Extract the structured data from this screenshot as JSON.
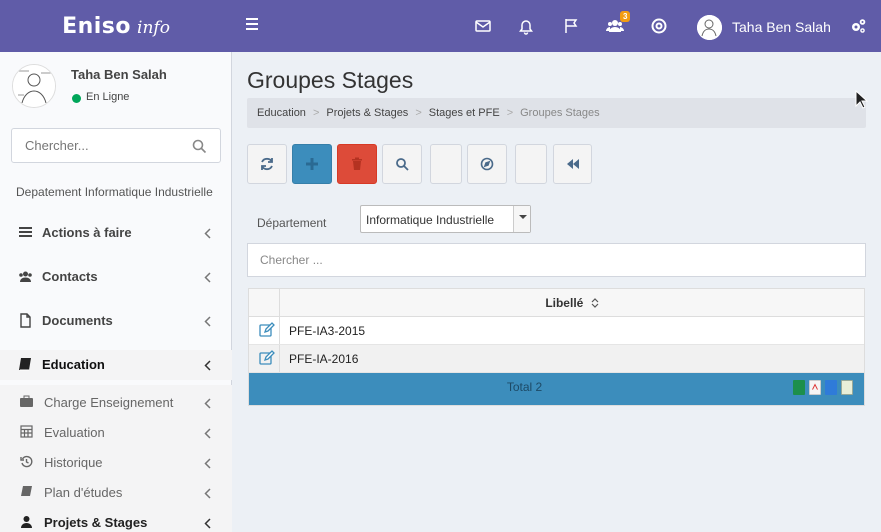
{
  "brand": {
    "name": "Eniso",
    "suffix": "info"
  },
  "topbar": {
    "badge_count": "3",
    "user_name": "Taha Ben Salah"
  },
  "sidebar": {
    "user_name": "Taha Ben Salah",
    "status": "En Ligne",
    "search_placeholder": "Chercher...",
    "header": "Depatement Informatique Industrielle",
    "items": [
      {
        "label": "Actions à faire",
        "icon": "list-icon"
      },
      {
        "label": "Contacts",
        "icon": "users-icon"
      },
      {
        "label": "Documents",
        "icon": "file-icon"
      },
      {
        "label": "Education",
        "icon": "book-icon"
      }
    ],
    "subitems": [
      {
        "label": "Charge Enseignement",
        "icon": "briefcase-icon"
      },
      {
        "label": "Evaluation",
        "icon": "calculator-icon"
      },
      {
        "label": "Historique",
        "icon": "history-icon"
      },
      {
        "label": "Plan d'études",
        "icon": "book-icon"
      },
      {
        "label": "Projets & Stages",
        "icon": "graduate-icon"
      }
    ]
  },
  "page": {
    "title": "Groupes Stages",
    "breadcrumb": [
      "Education",
      "Projets & Stages",
      "Stages et PFE",
      "Groupes Stages"
    ]
  },
  "filter": {
    "department_label": "Département",
    "department_value": "Informatique Industrielle",
    "search_placeholder": "Chercher ..."
  },
  "table": {
    "column": "Libellé",
    "rows": [
      "PFE-IA3-2015",
      "PFE-IA-2016"
    ],
    "footer": "Total 2"
  },
  "colors": {
    "topbar": "#605ca8",
    "primary": "#3c8dbc",
    "danger": "#dd4b39",
    "success": "#00a65a"
  }
}
